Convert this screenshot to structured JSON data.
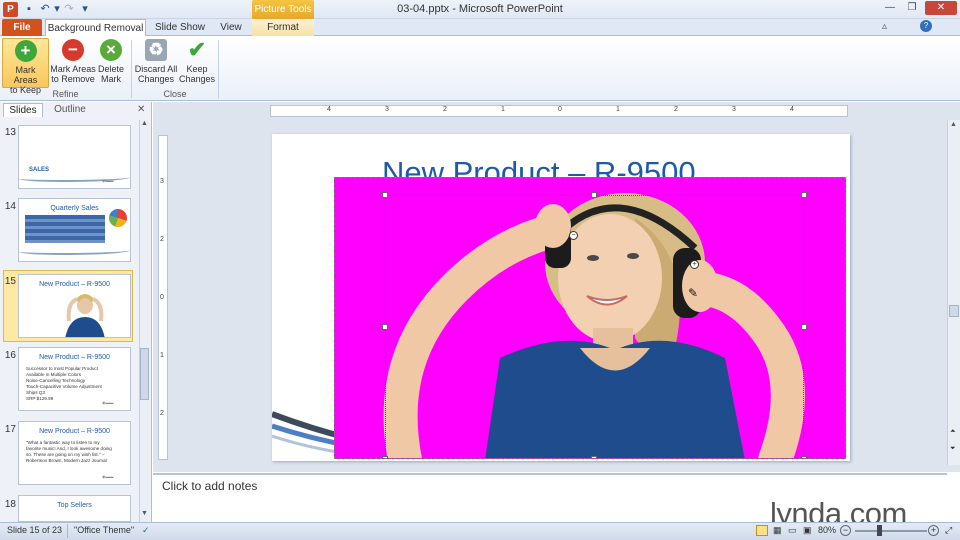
{
  "window": {
    "title": "03-04.pptx - Microsoft PowerPoint",
    "context_tab_group": "Picture Tools",
    "app_icon": "P"
  },
  "tabs": {
    "file": "File",
    "background_removal": "Background Removal",
    "slide_show": "Slide Show",
    "view": "View",
    "format": "Format"
  },
  "ribbon": {
    "mark_keep": [
      "Mark Areas",
      "to Keep"
    ],
    "mark_remove": [
      "Mark Areas",
      "to Remove"
    ],
    "delete_mark": [
      "Delete",
      "Mark"
    ],
    "discard_changes": [
      "Discard All",
      "Changes"
    ],
    "keep_changes": [
      "Keep",
      "Changes"
    ],
    "group_refine": "Refine",
    "group_close": "Close"
  },
  "pane_tabs": {
    "slides": "Slides",
    "outline": "Outline"
  },
  "thumbnails": [
    {
      "num": "13",
      "title": "SALES"
    },
    {
      "num": "14",
      "title": "Quarterly Sales"
    },
    {
      "num": "15",
      "title": "New Product – R-9500"
    },
    {
      "num": "16",
      "title": "New Product – R-9500",
      "bullets": [
        "Successor to most Popular Product",
        "Available in Multiple Colors",
        "Noise-Cancelling Technology",
        "Touch-Capacitive Volume Adjustment",
        "Ships Q3",
        "SRP $129.99"
      ]
    },
    {
      "num": "17",
      "title": "New Product – R-9500",
      "bullets": [
        "\"What a fantastic way to listen to my",
        "favorite music! And, I look awesome doing",
        "so. These are going on my wish list.\" –",
        "Robertson Brown, Modern Jazz Journal"
      ]
    },
    {
      "num": "18",
      "title": "Top Sellers"
    }
  ],
  "slide": {
    "title": "New Product – R-9500"
  },
  "ruler": {
    "h_ticks": [
      "4",
      "3",
      "2",
      "1",
      "0",
      "1",
      "2",
      "3",
      "4"
    ],
    "v_ticks": [
      "3",
      "2",
      "1",
      "0",
      "1",
      "2"
    ]
  },
  "notes": {
    "placeholder": "Click to add notes"
  },
  "watermark": "lynda.com",
  "status": {
    "slide": "Slide 15 of 23",
    "theme": "\"Office Theme\"",
    "zoom": "80%"
  },
  "colors": {
    "accent": "#1f5aa8",
    "removal_overlay": "#ff00ff",
    "file_tab": "#d0531f"
  }
}
